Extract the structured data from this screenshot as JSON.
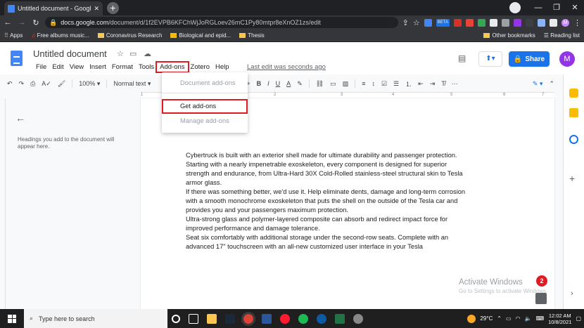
{
  "browser": {
    "tab_title": "Untitled document - Google Do",
    "new_tab": "+",
    "url_domain": "docs.google.com",
    "url_path": "/document/d/1f2EVPB6KFChWjJoRGLoev26mC1Py80mtpr8eXnOZ1zs/edit",
    "extension_badge": "BETA",
    "profile_initial": "M",
    "bookmarks": [
      "Apps",
      "Free albums music...",
      "Coronavirus Research",
      "Biological and epid...",
      "Thesis"
    ],
    "other_bookmarks": "Other bookmarks",
    "reading_list": "Reading list"
  },
  "docs": {
    "title": "Untitled document",
    "menu": [
      "File",
      "Edit",
      "View",
      "Insert",
      "Format",
      "Tools",
      "Add-ons",
      "Zotero",
      "Help"
    ],
    "last_edit": "Last edit was seconds ago",
    "share_label": "Share",
    "avatar_initial": "M",
    "toolbar": {
      "zoom": "100%",
      "style": "Normal text"
    },
    "ruler_marks": [
      "1",
      "2",
      "3",
      "4",
      "5",
      "6",
      "7"
    ],
    "outline_hint": "Headings you add to the document will appear here.",
    "body": [
      "Cybertruck is built with an exterior shell made for ultimate durability and passenger protection. Starting with a nearly impenetrable exoskeleton, every component is designed for superior strength and endurance, from Ultra-Hard 30X Cold-Rolled stainless-steel structural skin to Tesla armor glass.",
      "If there was something better, we'd use it. Help eliminate dents, damage and long-term corrosion with a smooth monochrome exoskeleton that puts the shell on the outside of the Tesla car and provides you and your passengers maximum protection.",
      "Ultra-strong glass and polymer-layered composite can absorb and redirect impact force for improved performance and damage tolerance.",
      "Seat six comfortably with additional storage under the second-row seats. Complete with an advanced 17\" touchscreen with an all-new customized user interface in your Tesla"
    ],
    "addons_dropdown": [
      "Document add-ons",
      "Get add-ons",
      "Manage add-ons"
    ]
  },
  "watermark": {
    "line1": "Activate Windows",
    "line2": "Go to Settings to activate Windows."
  },
  "notification_count": "2",
  "taskbar": {
    "search_placeholder": "Type here to search",
    "temperature": "29°C",
    "time": "12:02 AM",
    "date": "10/8/2021"
  }
}
